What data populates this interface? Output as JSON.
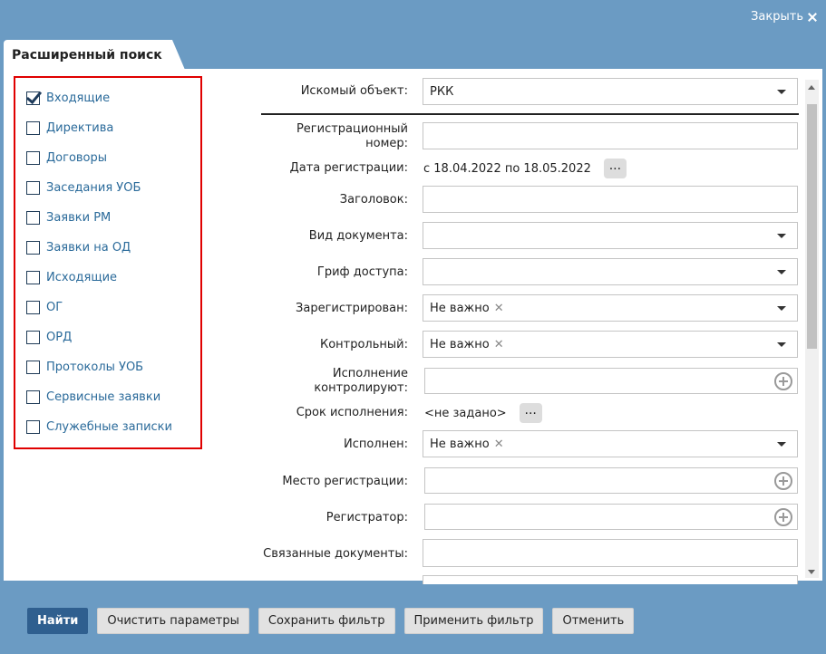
{
  "header": {
    "close_label": "Закрыть"
  },
  "tab": {
    "title": "Расширенный поиск"
  },
  "categories": [
    {
      "label": "Входящие",
      "checked": true
    },
    {
      "label": "Директива",
      "checked": false
    },
    {
      "label": "Договоры",
      "checked": false
    },
    {
      "label": "Заседания УОБ",
      "checked": false
    },
    {
      "label": "Заявки РМ",
      "checked": false
    },
    {
      "label": "Заявки на ОД",
      "checked": false
    },
    {
      "label": "Исходящие",
      "checked": false
    },
    {
      "label": "ОГ",
      "checked": false
    },
    {
      "label": "ОРД",
      "checked": false
    },
    {
      "label": "Протоколы УОБ",
      "checked": false
    },
    {
      "label": "Сервисные заявки",
      "checked": false
    },
    {
      "label": "Служебные записки",
      "checked": false
    }
  ],
  "form": {
    "search_object": {
      "label": "Искомый объект:",
      "value": "РКК"
    },
    "reg_number": {
      "label_line1": "Регистрационный",
      "label_line2": "номер:",
      "value": ""
    },
    "reg_date": {
      "label": "Дата регистрации:",
      "value": "с 18.04.2022 по 18.05.2022",
      "button": "..."
    },
    "title": {
      "label": "Заголовок:",
      "value": ""
    },
    "doc_type": {
      "label": "Вид документа:",
      "value": ""
    },
    "access": {
      "label": "Гриф доступа:",
      "value": ""
    },
    "registered": {
      "label": "Зарегистрирован:",
      "value": "Не важно"
    },
    "control": {
      "label": "Контрольный:",
      "value": "Не важно"
    },
    "controllers": {
      "label_line1": "Исполнение",
      "label_line2": "контролируют:",
      "value": ""
    },
    "deadline": {
      "label": "Срок исполнения:",
      "value": "<не задано>",
      "button": "..."
    },
    "executed": {
      "label": "Исполнен:",
      "value": "Не важно"
    },
    "reg_place": {
      "label": "Место регистрации:",
      "value": ""
    },
    "registrar": {
      "label": "Регистратор:",
      "value": ""
    },
    "related": {
      "label": "Связанные документы:",
      "value": ""
    }
  },
  "tag_remove_glyph": "✕",
  "footer": {
    "find": "Найти",
    "clear": "Очистить параметры",
    "save_filter": "Сохранить фильтр",
    "apply_filter": "Применить фильтр",
    "cancel": "Отменить"
  }
}
